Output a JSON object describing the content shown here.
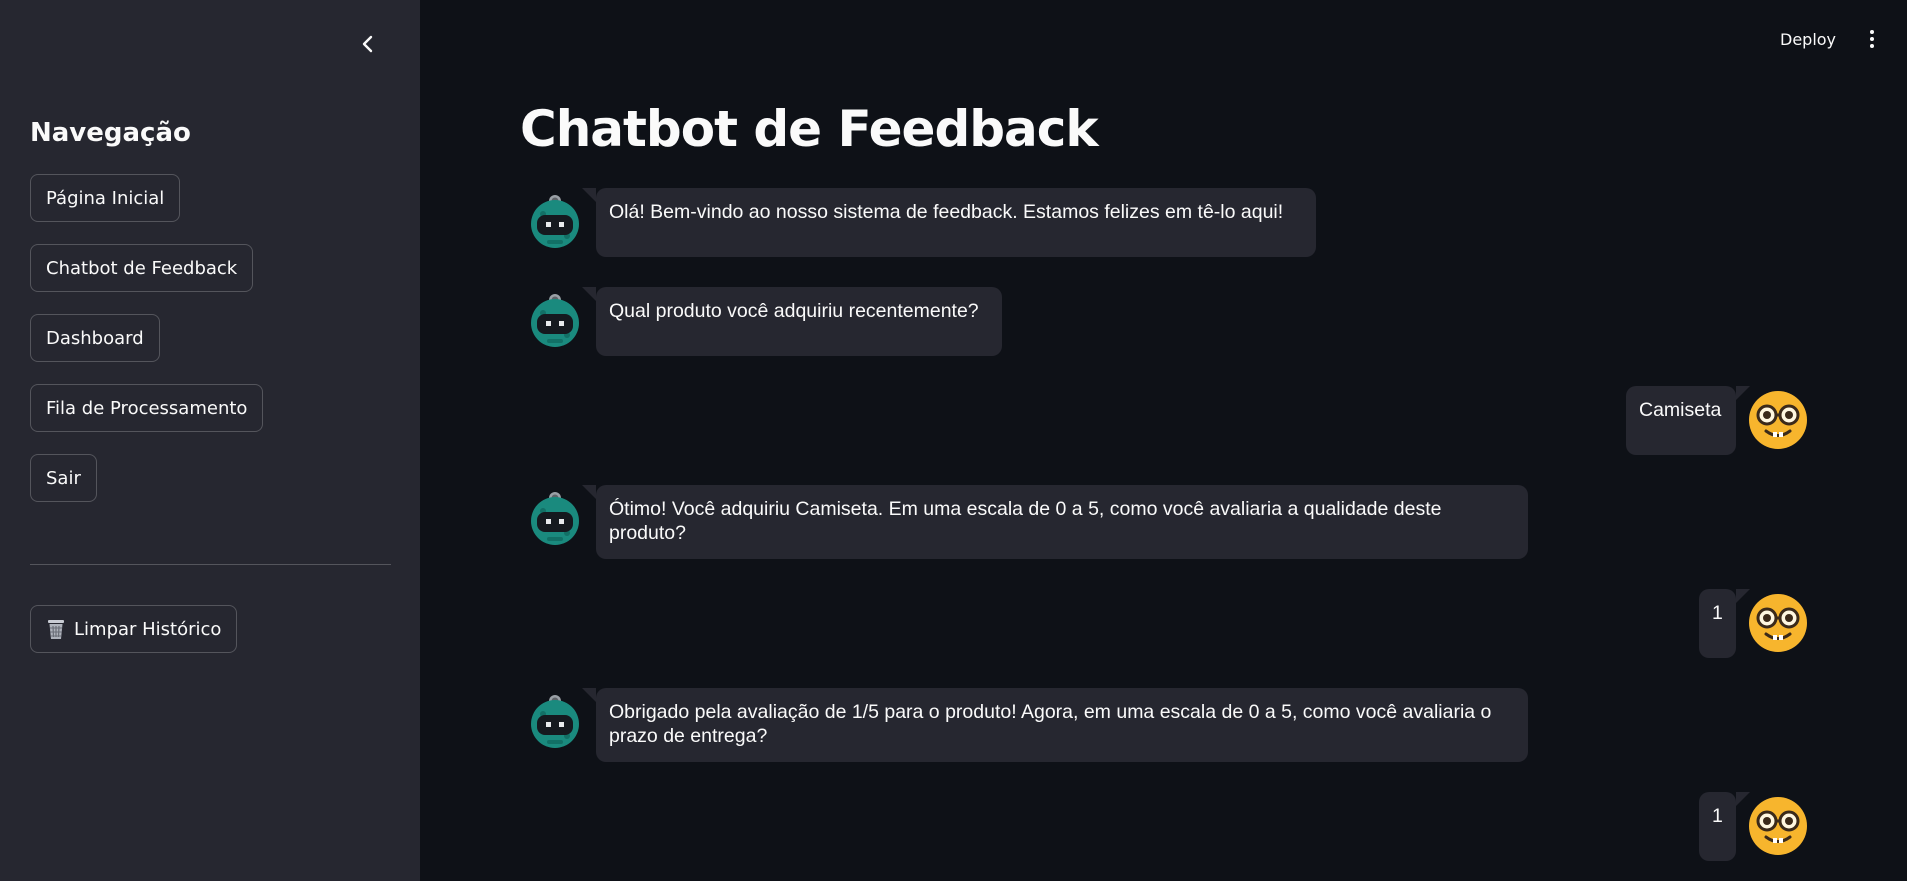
{
  "sidebar": {
    "heading": "Navegação",
    "nav_items": [
      {
        "label": "Página Inicial"
      },
      {
        "label": "Chatbot de Feedback"
      },
      {
        "label": "Dashboard"
      },
      {
        "label": "Fila de Processamento"
      },
      {
        "label": "Sair"
      }
    ],
    "clear_button": {
      "label": "Limpar Histórico",
      "icon": "wastebasket-icon"
    },
    "collapse_icon": "chevron-left-icon"
  },
  "header": {
    "deploy_label": "Deploy",
    "menu_icon": "vertical-ellipsis-icon"
  },
  "main": {
    "title": "Chatbot de Feedback",
    "messages": [
      {
        "role": "assistant",
        "avatar": "robot-icon",
        "text": "Olá! Bem-vindo ao nosso sistema de feedback. Estamos felizes em tê-lo aqui!"
      },
      {
        "role": "assistant",
        "avatar": "robot-icon",
        "text": "Qual produto você adquiriu recentemente?"
      },
      {
        "role": "user",
        "avatar": "nerd-face-icon",
        "text": "Camiseta"
      },
      {
        "role": "assistant",
        "avatar": "robot-icon",
        "text": "Ótimo! Você adquiriu Camiseta. Em uma escala de 0 a 5, como você avaliaria a qualidade deste produto?"
      },
      {
        "role": "user",
        "avatar": "nerd-face-icon",
        "text": "1"
      },
      {
        "role": "assistant",
        "avatar": "robot-icon",
        "text": "Obrigado pela avaliação de 1/5 para o produto! Agora, em uma escala de 0 a 5, como você avaliaria o prazo de entrega?"
      },
      {
        "role": "user",
        "avatar": "nerd-face-icon",
        "text": "1"
      }
    ]
  },
  "colors": {
    "background": "#0e1117",
    "sidebar": "#262730",
    "bubble": "#262730",
    "text": "#fafafa",
    "robot": "#1a8a7e",
    "nerd_face": "#f7b52d"
  }
}
